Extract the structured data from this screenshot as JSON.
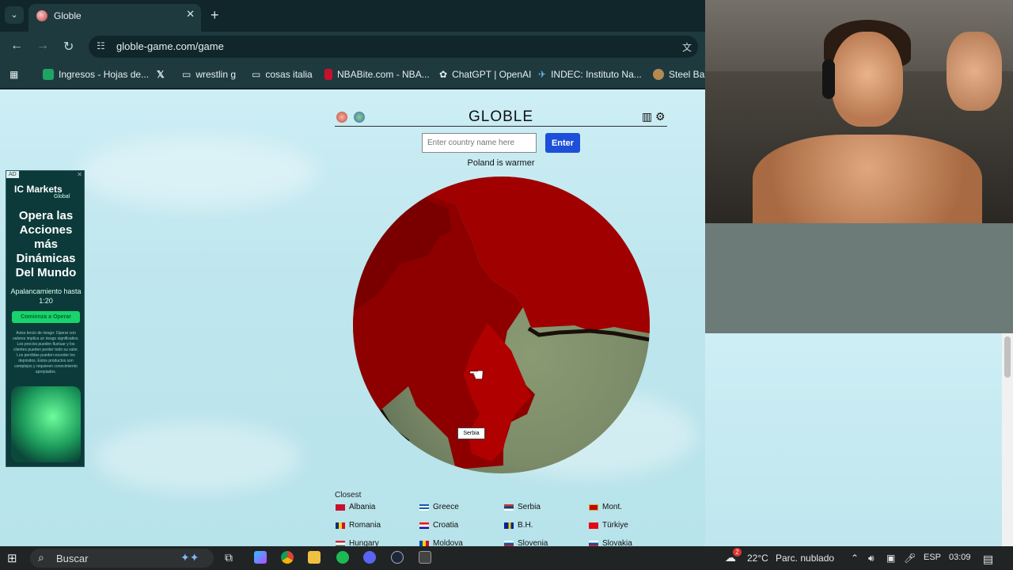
{
  "browser": {
    "tab_title": "Globle",
    "url": "globle-game.com/game",
    "bookmarks": [
      "Ingresos - Hojas de...",
      "",
      "wrestlin g",
      "cosas italia",
      "NBABite.com - NBA...",
      "ChatGPT | OpenAI",
      "INDEC: Instituto Na...",
      "Steel Ball"
    ]
  },
  "ad": {
    "tag": "AD",
    "brand": "IC Markets",
    "brand_sub": "Global",
    "headline": "Opera las Acciones más Dinámicas Del Mundo",
    "sub": "Apalancamiento hasta 1:20",
    "button": "Comienza a Operar",
    "fine_print": "Aviso tercio de riesgo: Operar con valores implica un riesgo significativo. Los precios pueden fluctuar y los clientes pueden perder todo su valor. Los perdidas pueden exceder los depósitos. Estos productos son complejos y requieren conocimiento apropiados."
  },
  "game": {
    "title": "GLOBLE",
    "input_placeholder": "Enter country name here",
    "enter_label": "Enter",
    "hint": "Poland is warmer",
    "globe_label": "Serbia",
    "closest_title": "Closest",
    "guesses": [
      [
        "Albania",
        "Greece",
        "Serbia",
        "Mont."
      ],
      [
        "Romania",
        "Croatia",
        "B.H.",
        "Türkiye"
      ],
      [
        "Hungary",
        "Moldova",
        "Slovenia",
        "Slovakia"
      ]
    ]
  },
  "taskbar": {
    "search_text": "Buscar",
    "weather_temp": "22°C",
    "weather_text": "Parc. nublado",
    "weather_badge": "2",
    "language": "ESP",
    "time": "03:09"
  },
  "colors": {
    "guess_red": "#a00000",
    "guess_dark_red": "#8e0000",
    "enter_blue": "#1d4fd8"
  }
}
